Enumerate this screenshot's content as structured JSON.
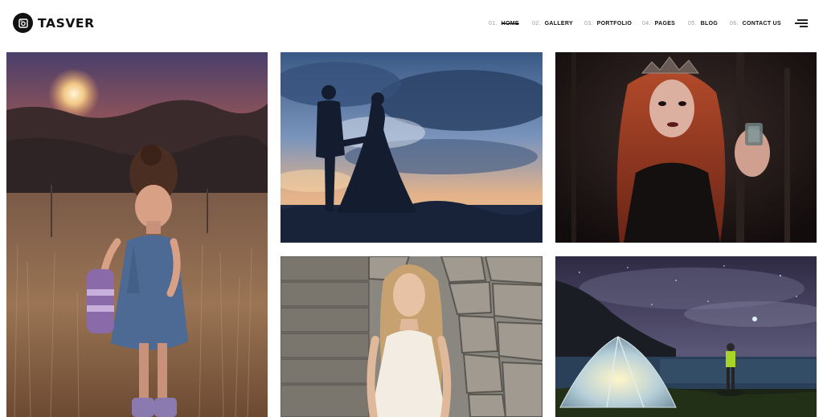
{
  "brand": {
    "name": "TASVER",
    "logo_icon": "camera-icon"
  },
  "nav": [
    {
      "num": "01.",
      "label": "HOME",
      "active": true
    },
    {
      "num": "02.",
      "label": "GALLERY",
      "active": false
    },
    {
      "num": "03.",
      "label": "PORTFOLIO",
      "active": false
    },
    {
      "num": "04.",
      "label": "PAGES",
      "active": false
    },
    {
      "num": "05.",
      "label": "BLOG",
      "active": false
    },
    {
      "num": "06.",
      "label": "CONTACT US",
      "active": false
    }
  ],
  "menu_icon": "hamburger-menu-icon",
  "gallery": [
    {
      "subject": "girl-in-field-at-sunset"
    },
    {
      "subject": "couple-silhouette-at-dusk"
    },
    {
      "subject": "woman-with-crown-holding-glass"
    },
    {
      "subject": "woman-sitting-on-stone-steps"
    },
    {
      "subject": "tent-under-night-sky"
    }
  ],
  "colors": {
    "text": "#111111",
    "muted": "#9a9a9a",
    "background": "#ffffff"
  }
}
